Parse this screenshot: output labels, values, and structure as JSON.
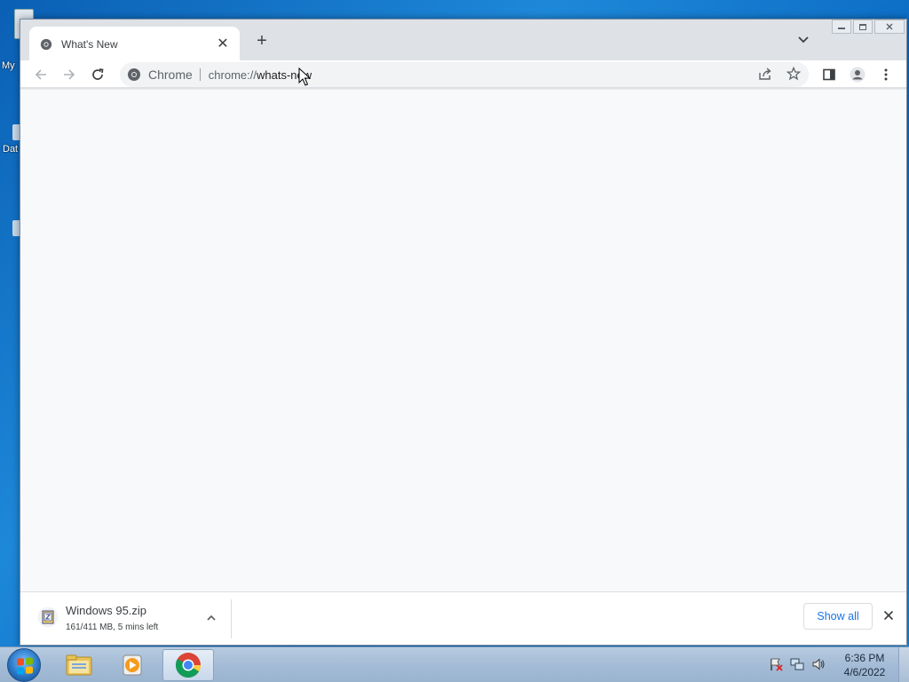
{
  "desktop": {
    "icons": [
      {
        "label": "My",
        "icon": "computer-icon"
      },
      {
        "label": "Dat",
        "icon": "document-icon"
      },
      {
        "label": "",
        "icon": "document-icon"
      }
    ]
  },
  "window": {
    "caption": {
      "minimize_icon": "minimize-icon",
      "restore_icon": "restore-icon",
      "close_icon": "close-icon"
    }
  },
  "tab": {
    "title": "What's New",
    "close_glyph": "✕",
    "favicon": "chrome-icon"
  },
  "newtab_glyph": "+",
  "toolbar": {
    "back_icon": "arrow-left-icon",
    "forward_icon": "arrow-right-icon",
    "reload_icon": "reload-icon",
    "omnibox": {
      "chip_label": "Chrome",
      "url_scheme": "chrome://",
      "url_path": "whats-new"
    },
    "share_icon": "share-icon",
    "bookmark_icon": "star-icon",
    "sidepanel_icon": "side-panel-icon",
    "profile_icon": "profile-icon",
    "menu_icon": "kebab-menu-icon"
  },
  "downloads": {
    "item": {
      "filename": "Windows 95.zip",
      "status": "161/411 MB, 5 mins left"
    },
    "show_all_label": "Show all"
  },
  "taskbar": {
    "apps": [
      "windows-explorer",
      "windows-media-player",
      "google-chrome"
    ],
    "clock": {
      "time": "6:36 PM",
      "date": "4/6/2022"
    }
  },
  "colors": {
    "accent": "#1a73e8",
    "tabstrip": "#dee1e6",
    "content_bg": "#f8f9fa",
    "desktop": "#1e88d8"
  }
}
